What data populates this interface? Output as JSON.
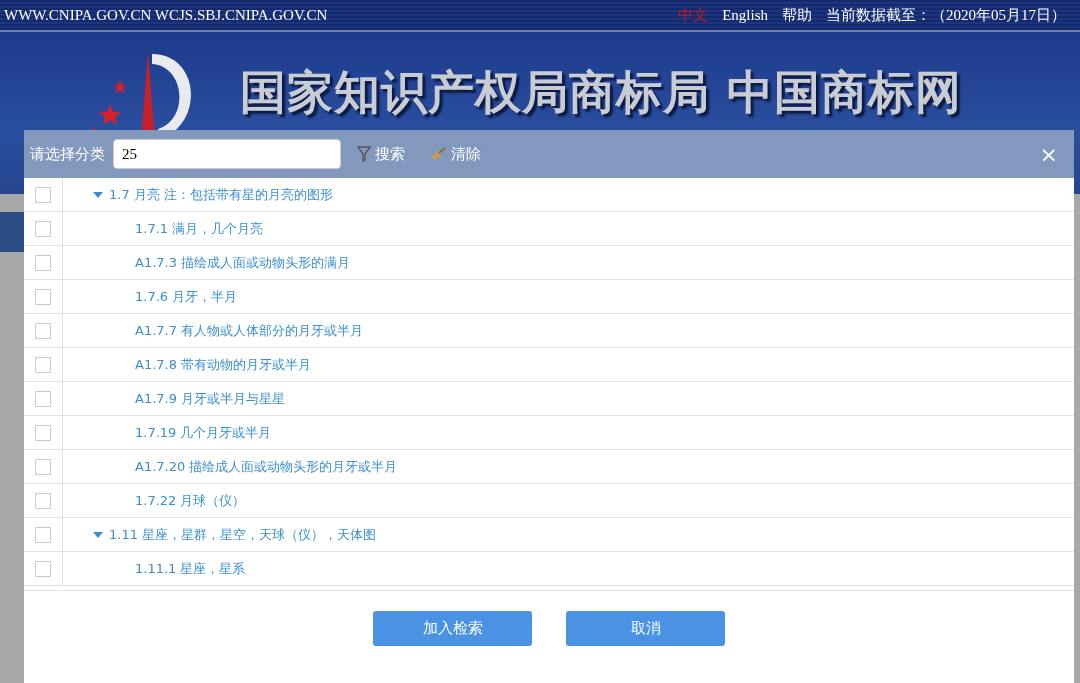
{
  "top_bar": {
    "sites": "WWW.CNIPA.GOV.CN WCJS.SBJ.CNIPA.GOV.CN",
    "links": [
      {
        "label": "中文",
        "selected": true
      },
      {
        "label": "English",
        "selected": false
      },
      {
        "label": "帮助",
        "selected": false
      }
    ],
    "data_date": "当前数据截至：（2020年05月17日）"
  },
  "banner": {
    "title": "国家知识产权局商标局 中国商标网"
  },
  "dialog": {
    "filter_label": "请选择分类",
    "filter_value": "25",
    "search_button": "搜索",
    "clear_button": "清除",
    "close": "×",
    "tree": [
      {
        "label": "1.7 月亮 注：包括带有星的月亮的图形",
        "checked": false,
        "expanded": true,
        "children": [
          {
            "label": "1.7.1 满月，几个月亮",
            "checked": false
          },
          {
            "label": "A1.7.3 描绘成人面或动物头形的满月",
            "checked": false
          },
          {
            "label": "1.7.6 月牙，半月",
            "checked": false
          },
          {
            "label": "A1.7.7 有人物或人体部分的月牙或半月",
            "checked": false
          },
          {
            "label": "A1.7.8 带有动物的月牙或半月",
            "checked": false
          },
          {
            "label": "A1.7.9 月牙或半月与星星",
            "checked": false
          },
          {
            "label": "1.7.19 几个月牙或半月",
            "checked": false
          },
          {
            "label": "A1.7.20 描绘成人面或动物头形的月牙或半月",
            "checked": false
          },
          {
            "label": "1.7.22 月球（仪）",
            "checked": false
          }
        ]
      },
      {
        "label": "1.11 星座，星群，星空，天球（仪），天体图",
        "checked": false,
        "expanded": true,
        "children": [
          {
            "label": "1.11.1 星座，星系",
            "checked": false
          }
        ]
      }
    ],
    "buttons": [
      "加入检索",
      "取消"
    ]
  }
}
